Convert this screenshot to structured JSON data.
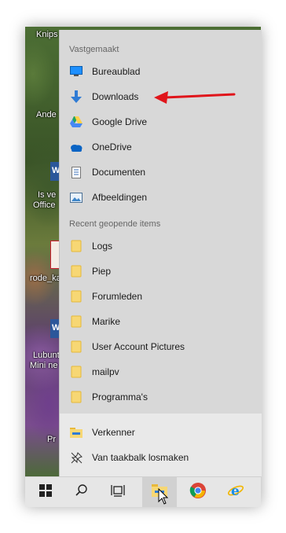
{
  "desktop": {
    "labels": [
      "Knips",
      "Ande",
      "Is ve",
      "Office",
      "rode_ka",
      "Lubunt",
      "Mini ne",
      "Pr"
    ]
  },
  "start_menu": {
    "pinned_header": "Vastgemaakt",
    "pinned": [
      {
        "label": "Bureaublad",
        "icon": "desktop-icon"
      },
      {
        "label": "Downloads",
        "icon": "download-arrow-icon"
      },
      {
        "label": "Google Drive",
        "icon": "google-drive-icon"
      },
      {
        "label": "OneDrive",
        "icon": "onedrive-cloud-icon"
      },
      {
        "label": "Documenten",
        "icon": "document-icon"
      },
      {
        "label": "Afbeeldingen",
        "icon": "pictures-icon"
      }
    ],
    "recent_header": "Recent geopende items",
    "recent": [
      {
        "label": "Logs",
        "icon": "folder-icon"
      },
      {
        "label": "Piep",
        "icon": "folder-icon"
      },
      {
        "label": "Forumleden",
        "icon": "folder-icon"
      },
      {
        "label": "Marike",
        "icon": "folder-icon"
      },
      {
        "label": "User Account Pictures",
        "icon": "folder-icon"
      },
      {
        "label": "mailpv",
        "icon": "folder-icon"
      },
      {
        "label": "Programma's",
        "icon": "folder-icon"
      }
    ],
    "footer": [
      {
        "label": "Verkenner",
        "icon": "file-explorer-icon"
      },
      {
        "label": "Van taakbalk losmaken",
        "icon": "unpin-icon"
      }
    ]
  },
  "taskbar": {
    "buttons": [
      "windows-start-icon",
      "search-icon",
      "task-view-icon",
      "file-explorer-icon",
      "chrome-icon",
      "internet-explorer-icon"
    ],
    "active": "file-explorer-icon"
  },
  "annotation": {
    "arrow_color": "#e0151b"
  }
}
